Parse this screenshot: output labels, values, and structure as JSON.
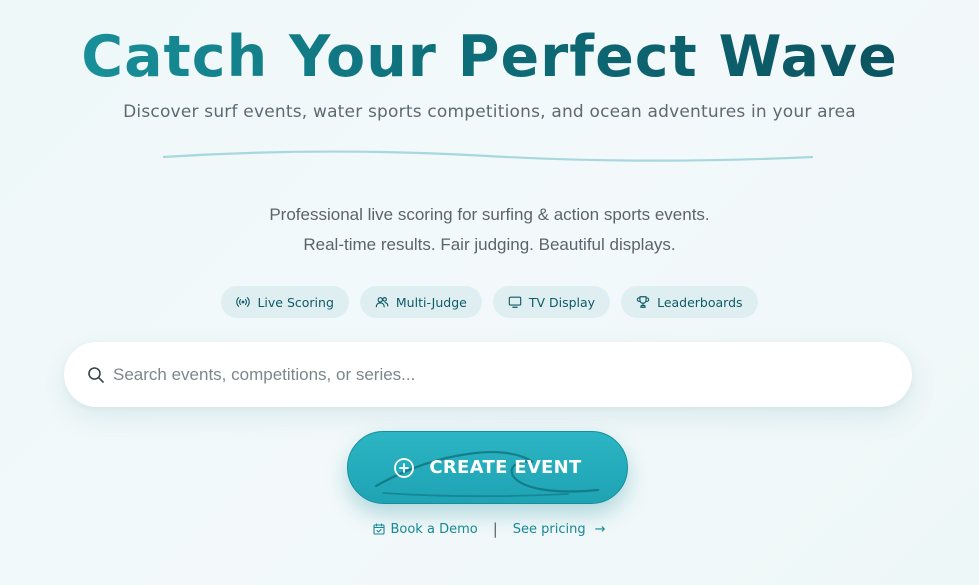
{
  "hero": {
    "title": "Catch Your Perfect Wave",
    "subtitle": "Discover surf events, water sports competitions, and ocean adventures in your area"
  },
  "tagline": {
    "line1": "Professional live scoring for surfing & action sports events.",
    "line2": "Real-time results. Fair judging. Beautiful displays."
  },
  "features": [
    {
      "label": "Live Scoring",
      "icon": "broadcast-icon"
    },
    {
      "label": "Multi-Judge",
      "icon": "users-icon"
    },
    {
      "label": "TV Display",
      "icon": "monitor-icon"
    },
    {
      "label": "Leaderboards",
      "icon": "trophy-icon"
    }
  ],
  "search": {
    "placeholder": "Search events, competitions, or series...",
    "value": ""
  },
  "cta": {
    "label": "CREATE EVENT"
  },
  "links": {
    "demo": "Book a Demo",
    "separator": "|",
    "pricing": "See pricing",
    "arrow": "→"
  },
  "colors": {
    "accent": "#1ea3b3",
    "title_dark": "#0b4f5c",
    "link": "#178895",
    "pill_bg": "#dfeff1"
  }
}
